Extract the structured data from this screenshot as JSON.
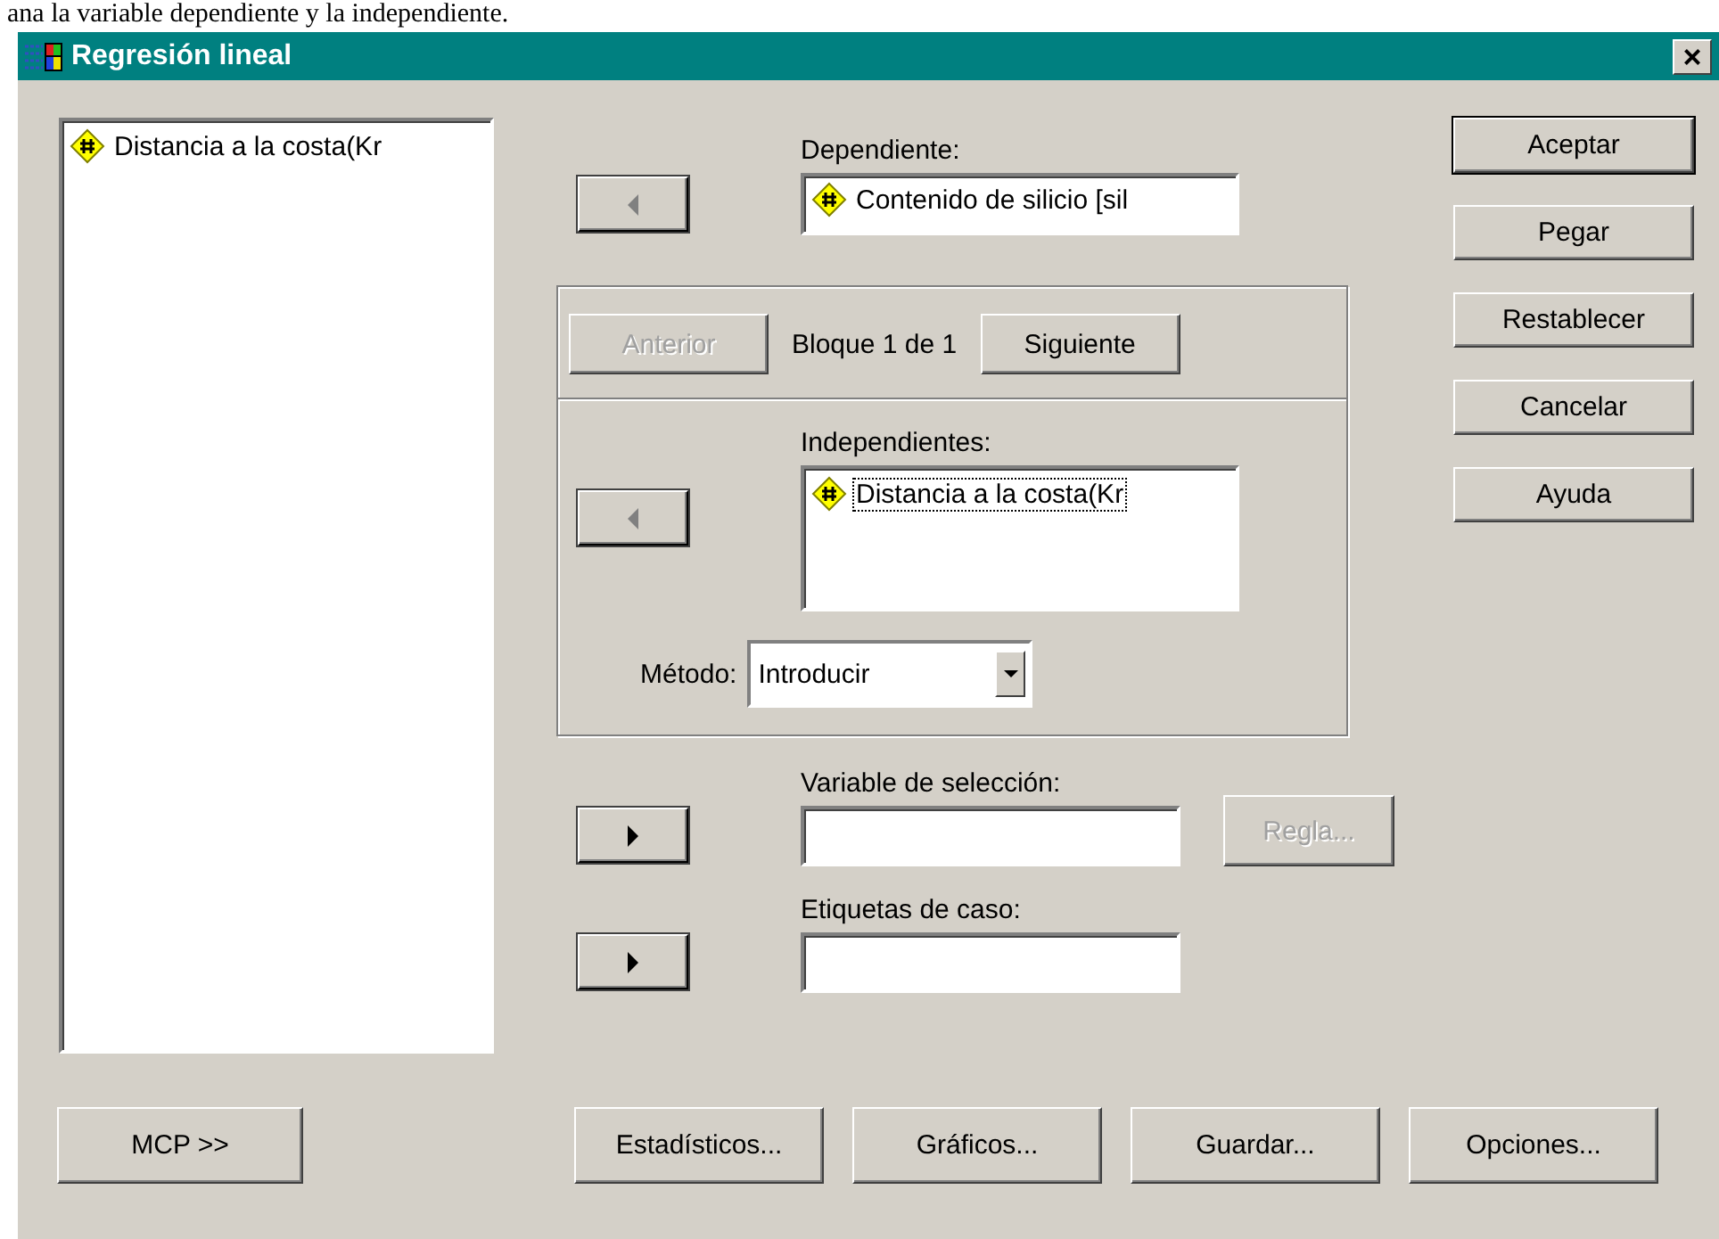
{
  "document_text": "ana la variable dependiente y la independiente.",
  "window": {
    "title": "Regresión lineal",
    "close": "×"
  },
  "source_list": {
    "items": [
      {
        "label": "Distancia a la costa(Kr",
        "focused": false
      }
    ]
  },
  "dependent": {
    "label": "Dependiente:",
    "move_button": {
      "kind": "left"
    },
    "items": [
      {
        "label": "Contenido de silicio [sil",
        "focused": false
      }
    ]
  },
  "block": {
    "previous": {
      "label": "Anterior",
      "disabled": true
    },
    "caption": "Bloque 1 de 1",
    "next": {
      "label": "Siguiente",
      "disabled": false
    }
  },
  "independents": {
    "label": "Independientes:",
    "move_button": {
      "kind": "left"
    },
    "items": [
      {
        "label": "Distancia a la costa(Kr",
        "focused": true
      }
    ]
  },
  "method": {
    "label": "Método:",
    "value": "Introducir"
  },
  "selection_variable": {
    "label": "Variable de selección:",
    "move_button": {
      "kind": "right"
    },
    "rule": {
      "label": "Regla...",
      "disabled": true
    }
  },
  "case_labels": {
    "label": "Etiquetas de caso:",
    "move_button": {
      "kind": "right"
    }
  },
  "side_buttons": [
    {
      "label": "Aceptar",
      "default": true
    },
    {
      "label": "Pegar",
      "default": false
    },
    {
      "label": "Restablecer",
      "default": false
    },
    {
      "label": "Cancelar",
      "default": false
    },
    {
      "label": "Ayuda",
      "default": false
    }
  ],
  "mcp_button": {
    "label": "MCP >>"
  },
  "bottom_buttons": [
    {
      "label": "Estadísticos..."
    },
    {
      "label": "Gráficos..."
    },
    {
      "label": "Guardar..."
    },
    {
      "label": "Opciones..."
    }
  ]
}
